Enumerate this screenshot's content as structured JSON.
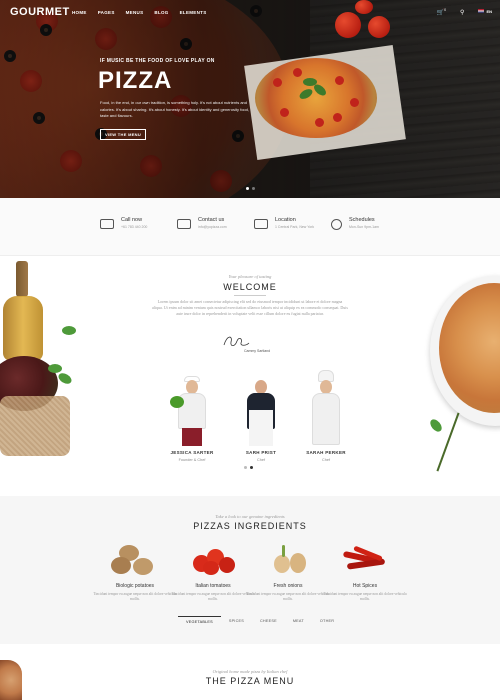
{
  "nav": {
    "logo": "GOURMET",
    "items": [
      "HOME",
      "PAGES",
      "MENUS",
      "BLOG",
      "ELEMENTS"
    ],
    "cart_count": "0",
    "lang": "EN"
  },
  "hero": {
    "tagline": "IF MUSIC BE THE FOOD OF LOVE PLAY ON",
    "title": "PIZZA",
    "description": "Food, in the end, in our own tradition, is something holy. It's not about nutrients and calories. It's about sharing. It's about honesty. It's about identity and generosity food, taste and flavours.",
    "button": "VIEW THE MENU"
  },
  "contacts": [
    {
      "title": "Call now",
      "sub": "+61 783 440 200",
      "icon": "phone-icon"
    },
    {
      "title": "Contact us",
      "sub": "info@yopizza.com",
      "icon": "mail-icon"
    },
    {
      "title": "Location",
      "sub": "1 Central Park, New York",
      "icon": "map-icon"
    },
    {
      "title": "Schedules",
      "sub": "Mon-Sun 9pm-1am",
      "icon": "clock-icon"
    }
  ],
  "welcome": {
    "kicker": "Your pleasure of tasting",
    "title": "WELCOME",
    "text": "Lorem ipsum dolor sit amet consectetur adipiscing elit sed do eiusmod tempor incididunt ut labore et dolore magna aliqua. Ut enim ad minim veniam quis nostrud exercitation ullamco laboris nisi ut aliquip ex ea commodo consequat. Duis aute irure dolor in reprehenderit in voluptate velit esse cillum dolore eu fugiat nulla pariatur.",
    "signature_name": "Cammy Sartland"
  },
  "chefs": [
    {
      "name": "JESSICA SARTER",
      "role": "Founder & Chef"
    },
    {
      "name": "SARH PRIST",
      "role": "Chef"
    },
    {
      "name": "SARAH PERKER",
      "role": "Chef"
    }
  ],
  "ingredients": {
    "kicker": "Take a look to our genuine ingredients",
    "title": "PIZZAS INGREDIENTS",
    "items": [
      {
        "name": "Biologic potatoes",
        "desc": "Tincidunt tempor eu augue neque non alit dolore vehicula mollis."
      },
      {
        "name": "Italian tomatoes",
        "desc": "Tincidunt tempor eu augue neque non alit dolore vehicula mollis."
      },
      {
        "name": "Fresh onions",
        "desc": "Tincidunt tempor eu augue neque non alit dolore vehicula mollis."
      },
      {
        "name": "Hot Spices",
        "desc": "Tincidunt tempor eu augue neque non alit dolore vehicula mollis."
      }
    ],
    "tabs": [
      "VEGETABLES",
      "SPICES",
      "CHEESE",
      "MEAT",
      "OTHER"
    ]
  },
  "menu": {
    "kicker": "Original home made pizza by Italian chef",
    "title": "THE PIZZA MENU"
  }
}
